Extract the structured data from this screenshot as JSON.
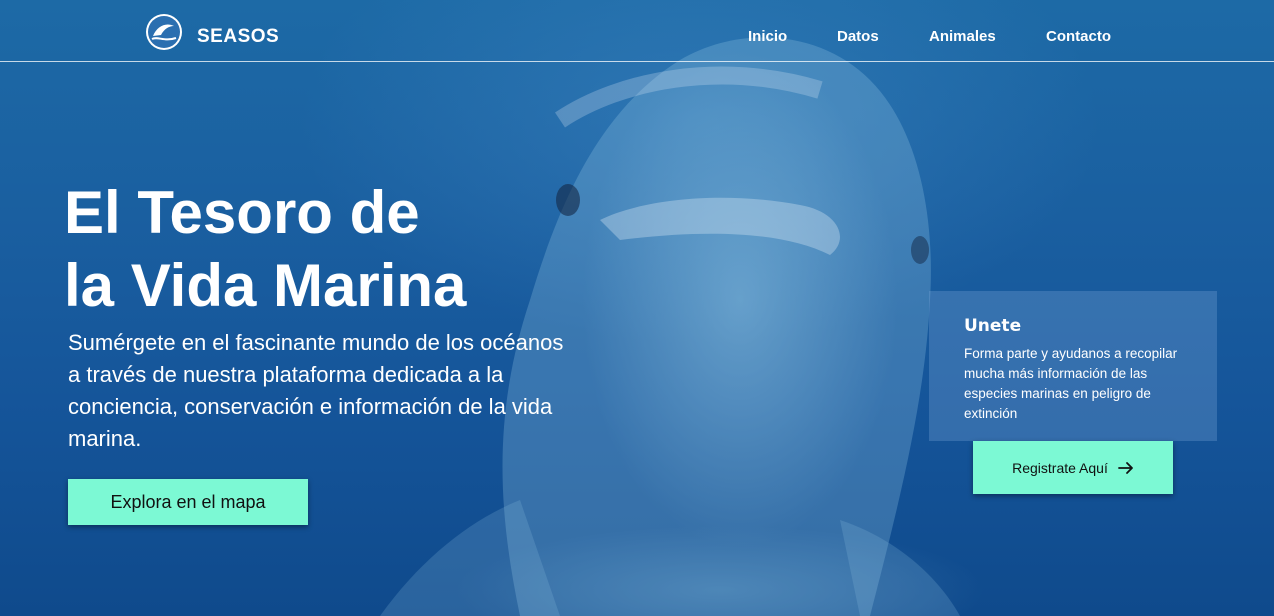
{
  "header": {
    "brand": "SEASOS",
    "logo_icon": "dolphin-wave-logo",
    "nav": [
      {
        "label": "Inicio"
      },
      {
        "label": "Datos"
      },
      {
        "label": "Animales"
      },
      {
        "label": "Contacto"
      }
    ]
  },
  "hero": {
    "title_line1": "El Tesoro de",
    "title_line2": "la Vida Marina",
    "subtitle": "Sumérgete en el fascinante mundo de los océanos a través de nuestra plataforma dedicada a la conciencia, conservación e información de la vida marina.",
    "cta_label": "Explora en el mapa"
  },
  "join_card": {
    "title": "Unete",
    "text": "Forma parte y ayudanos a recopilar mucha más información de las especies marinas en peligro de extinción",
    "button_label": "Registrate Aquí",
    "button_icon": "arrow-right-icon"
  },
  "colors": {
    "accent": "#7cf9d4",
    "ocean_blue": "#1a5fa0",
    "text": "#ffffff"
  }
}
